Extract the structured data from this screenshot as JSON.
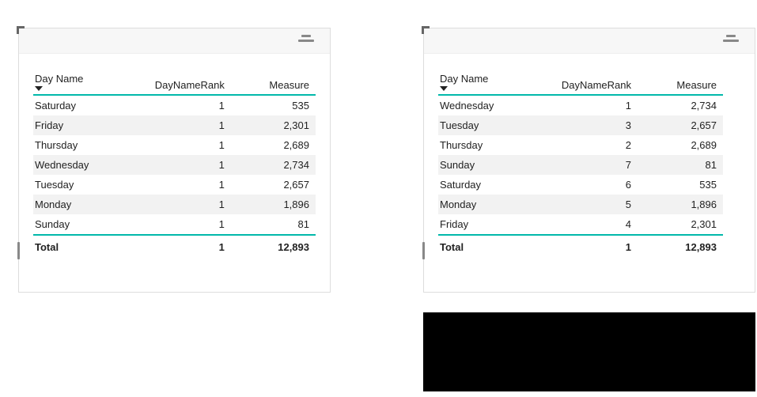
{
  "chart_data": [
    {
      "type": "table",
      "title": "",
      "columns": [
        "Day Name",
        "DayNameRank",
        "Measure"
      ],
      "rows": [
        [
          "Saturday",
          1,
          535
        ],
        [
          "Friday",
          1,
          2301
        ],
        [
          "Thursday",
          1,
          2689
        ],
        [
          "Wednesday",
          1,
          2734
        ],
        [
          "Tuesday",
          1,
          2657
        ],
        [
          "Monday",
          1,
          1896
        ],
        [
          "Sunday",
          1,
          81
        ]
      ],
      "total": [
        "Total",
        1,
        12893
      ],
      "sort_column": "Day Name",
      "sort_direction": "desc"
    },
    {
      "type": "table",
      "title": "",
      "columns": [
        "Day Name",
        "DayNameRank",
        "Measure"
      ],
      "rows": [
        [
          "Wednesday",
          1,
          2734
        ],
        [
          "Tuesday",
          3,
          2657
        ],
        [
          "Thursday",
          2,
          2689
        ],
        [
          "Sunday",
          7,
          81
        ],
        [
          "Saturday",
          6,
          535
        ],
        [
          "Monday",
          5,
          1896
        ],
        [
          "Friday",
          4,
          2301
        ]
      ],
      "total": [
        "Total",
        1,
        12893
      ],
      "sort_column": "Day Name",
      "sort_direction": "desc"
    }
  ],
  "left": {
    "headers": {
      "c0": "Day Name",
      "c1": "DayNameRank",
      "c2": "Measure"
    },
    "rows": [
      {
        "c0": "Saturday",
        "c1": "1",
        "c2": "535"
      },
      {
        "c0": "Friday",
        "c1": "1",
        "c2": "2,301"
      },
      {
        "c0": "Thursday",
        "c1": "1",
        "c2": "2,689"
      },
      {
        "c0": "Wednesday",
        "c1": "1",
        "c2": "2,734"
      },
      {
        "c0": "Tuesday",
        "c1": "1",
        "c2": "2,657"
      },
      {
        "c0": "Monday",
        "c1": "1",
        "c2": "1,896"
      },
      {
        "c0": "Sunday",
        "c1": "1",
        "c2": "81"
      }
    ],
    "total": {
      "c0": "Total",
      "c1": "1",
      "c2": "12,893"
    }
  },
  "right": {
    "headers": {
      "c0": "Day Name",
      "c1": "DayNameRank",
      "c2": "Measure"
    },
    "rows": [
      {
        "c0": "Wednesday",
        "c1": "1",
        "c2": "2,734"
      },
      {
        "c0": "Tuesday",
        "c1": "3",
        "c2": "2,657"
      },
      {
        "c0": "Thursday",
        "c1": "2",
        "c2": "2,689"
      },
      {
        "c0": "Sunday",
        "c1": "7",
        "c2": "81"
      },
      {
        "c0": "Saturday",
        "c1": "6",
        "c2": "535"
      },
      {
        "c0": "Monday",
        "c1": "5",
        "c2": "1,896"
      },
      {
        "c0": "Friday",
        "c1": "4",
        "c2": "2,301"
      }
    ],
    "total": {
      "c0": "Total",
      "c1": "1",
      "c2": "12,893"
    }
  }
}
